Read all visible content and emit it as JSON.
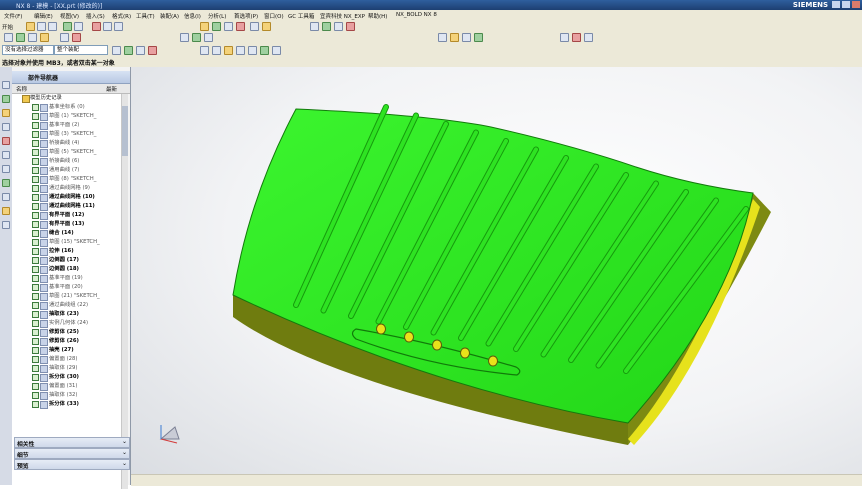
{
  "window": {
    "title": "NX 8 - 建模 - [XX.prt (修改的)]",
    "brand": "SIEMENS"
  },
  "menubar": {
    "items": [
      "文件(F)",
      "编辑(E)",
      "视图(V)",
      "插入(S)",
      "格式(R)",
      "工具(T)",
      "装配(A)",
      "信息(I)",
      "分析(L)",
      "首选项(P)",
      "窗口(O)",
      "GC 工具箱",
      "宜宾科技 NX_EXP",
      "帮助(H)",
      "NX_BOLD NX 8"
    ]
  },
  "toolbar": {
    "start_label": "开始",
    "filter_value": "没有选择过滤器",
    "assembly_value": "整个装配"
  },
  "cue_line": {
    "text": "选择对象并使用 MB3，或者双击某一对象"
  },
  "navigator": {
    "title": "部件导航器",
    "col_name": "名称",
    "col_latest": "最新",
    "root_label": "模型历史记录",
    "items": [
      "基准坐标系 (0)",
      "草图 (1) \"SKETCH_",
      "基准平面 (2)",
      "草图 (3) \"SKETCH_",
      "桥接曲线 (4)",
      "草图 (5) \"SKETCH_",
      "桥接曲线 (6)",
      "通用曲线 (7)",
      "草图 (8) \"SKETCH_",
      "通过曲线网格 (9)",
      "通过曲线网格 (10)",
      "通过曲线网格 (11)",
      "有界平面 (12)",
      "有界平面 (13)",
      "缝合 (14)",
      "草图 (15) \"SKETCH_",
      "拉伸 (16)",
      "边倒圆 (17)",
      "边倒圆 (18)",
      "基准平面 (19)",
      "基准平面 (20)",
      "草图 (21) \"SKETCH_",
      "通过曲线组 (22)",
      "抽取体 (23)",
      "实例几何体 (24)",
      "修剪体 (25)",
      "修剪体 (26)",
      "抽壳 (27)",
      "偏置面 (28)",
      "抽取体 (29)",
      "拆分体 (30)",
      "偏置面 (31)",
      "抽取体 (32)",
      "拆分体 (33)"
    ],
    "bold_flags": [
      false,
      false,
      false,
      false,
      false,
      false,
      false,
      false,
      false,
      false,
      true,
      true,
      true,
      true,
      true,
      false,
      true,
      true,
      true,
      false,
      false,
      false,
      false,
      true,
      false,
      true,
      true,
      true,
      false,
      false,
      true,
      false,
      false,
      true
    ]
  },
  "panels": {
    "dependencies": "相关性",
    "details": "细节",
    "preview": "预览"
  },
  "model": {
    "top_color": "#2bea1f",
    "side_color": "#7d8a12",
    "edge_color": "#e6e21c"
  }
}
